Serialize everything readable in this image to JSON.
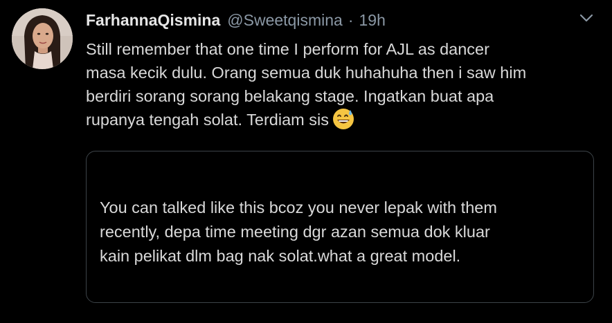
{
  "tweet": {
    "author": {
      "display_name": "FarhannaQismina",
      "handle": "@Sweetqismina",
      "separator": "·",
      "time": "19h",
      "avatar_icon": "profile-photo"
    },
    "text_lines": [
      "Still remember that one time I perform for AJL as dancer",
      "masa kecik dulu. Orang semua duk huhahuha then i saw him",
      "berdiri sorang sorang belakang stage. Ingatkan buat apa",
      "rupanya tengah solat. Terdiam sis"
    ],
    "emoji": "grinning-face-with-sweat",
    "menu_icon": "chevron-down-icon"
  },
  "quoted": {
    "text_lines": [
      "You can talked like this bcoz you never lepak with them",
      "recently, depa time meeting dgr azan semua dok kluar",
      "kain pelikat dlm bag nak solat.what a great model."
    ]
  },
  "colors": {
    "background": "#000000",
    "primary_text": "#d9d9d9",
    "secondary_text": "#8b98a5",
    "card_border": "#3d4449"
  }
}
